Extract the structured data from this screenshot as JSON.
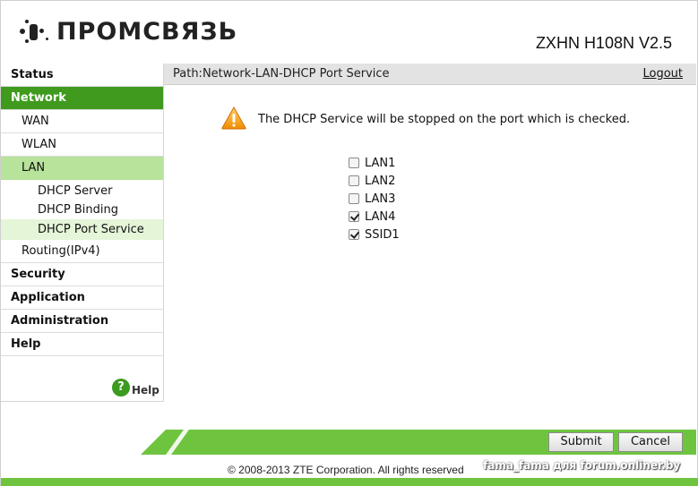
{
  "header": {
    "logo_text": "ПРОМСВЯЗЬ",
    "model": "ZXHN H108N V2.5"
  },
  "sidebar": {
    "items": [
      {
        "label": "Status"
      },
      {
        "label": "Network"
      },
      {
        "label": "WAN"
      },
      {
        "label": "WLAN"
      },
      {
        "label": "LAN"
      },
      {
        "label": "DHCP Server"
      },
      {
        "label": "DHCP Binding"
      },
      {
        "label": "DHCP Port Service"
      },
      {
        "label": "Routing(IPv4)"
      },
      {
        "label": "Security"
      },
      {
        "label": "Application"
      },
      {
        "label": "Administration"
      },
      {
        "label": "Help"
      }
    ],
    "help_icon": "?",
    "help_label": "Help"
  },
  "pathbar": {
    "path": "Path:Network-LAN-DHCP Port Service",
    "logout": "Logout"
  },
  "main": {
    "warning_icon": "warning-triangle-icon",
    "message": "The DHCP Service will be stopped on the port which is checked.",
    "ports": [
      {
        "label": "LAN1",
        "checked": false
      },
      {
        "label": "LAN2",
        "checked": false
      },
      {
        "label": "LAN3",
        "checked": false
      },
      {
        "label": "LAN4",
        "checked": true
      },
      {
        "label": "SSID1",
        "checked": true
      }
    ]
  },
  "footer": {
    "submit": "Submit",
    "cancel": "Cancel",
    "copyright": "© 2008-2013 ZTE Corporation. All rights reserved",
    "watermark": "fama_fama для forum.onliner.by"
  },
  "colors": {
    "accent_green": "#3f9a1e",
    "light_green": "#b7e39a",
    "bar_green": "#6fc43f"
  }
}
